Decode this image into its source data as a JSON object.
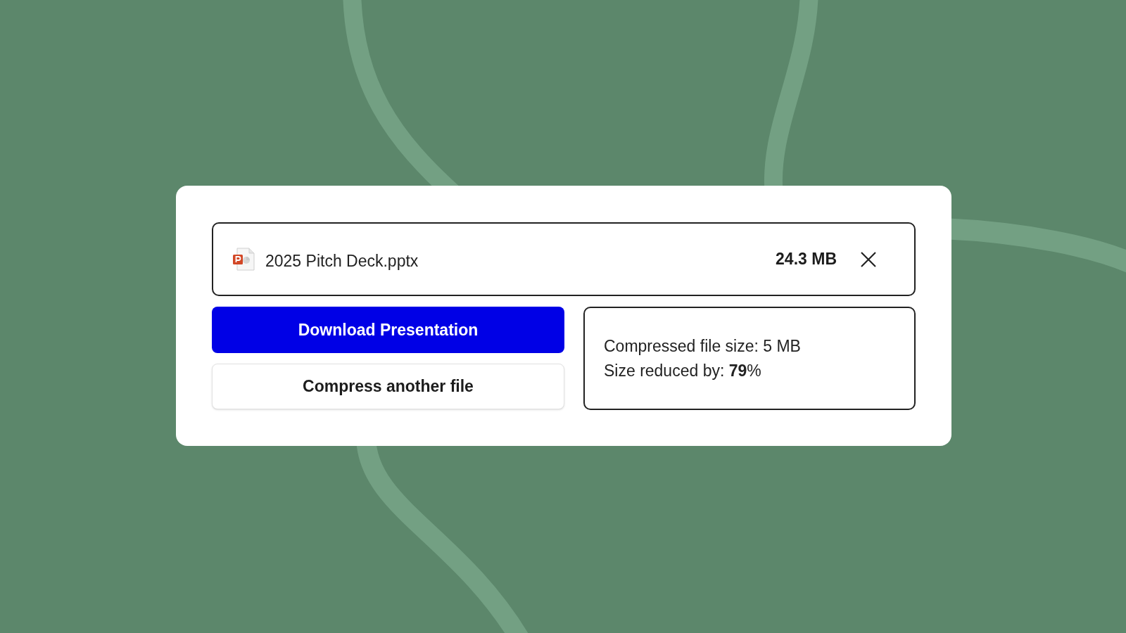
{
  "file": {
    "name": "2025 Pitch Deck.pptx",
    "size": "24.3 MB"
  },
  "actions": [
    {
      "label": "Download Presentation",
      "kind": "primary"
    },
    {
      "label": "Compress another file",
      "kind": "secondary"
    }
  ],
  "result": {
    "lines": [
      "Compressed file size: 5 MB",
      "Size reduced by: **79**%"
    ]
  }
}
